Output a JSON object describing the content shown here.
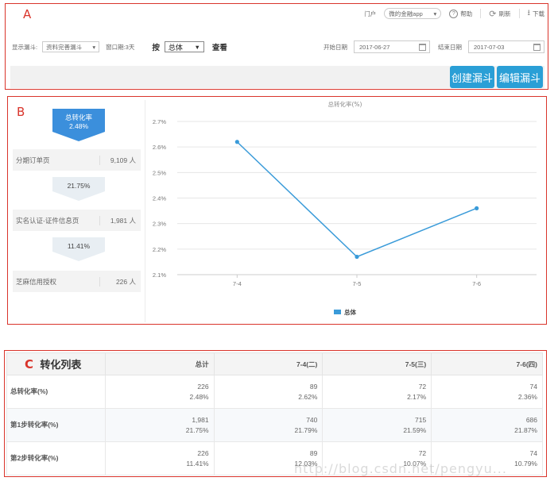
{
  "labels": {
    "a": "A",
    "b": "B",
    "c": "C"
  },
  "topbar": {
    "portal_label": "门户",
    "portal_value": "微的金融app",
    "help_label": "帮助",
    "refresh_label": "刷新",
    "download_label": "下载"
  },
  "filters": {
    "display_funnel_label": "显示漏斗:",
    "display_funnel_value": "资料完善漏斗",
    "window_label": "窗口期:3天",
    "by_label": "按",
    "dimension_value": "总体",
    "view_label": "查看",
    "start_date_label": "开始日期",
    "start_date": "2017-06-27",
    "end_date_label": "结束日期",
    "end_date": "2017-07-03"
  },
  "buttons": {
    "create": "创建漏斗",
    "edit": "编辑漏斗"
  },
  "funnel": {
    "total_label": "总转化率",
    "total_rate": "2.48%",
    "steps": [
      {
        "name": "分期订单页",
        "count": "9,109 人"
      },
      {
        "name": "实名认证-证件信息页",
        "count": "1,981 人"
      },
      {
        "name": "芝麻信用授权",
        "count": "226 人"
      }
    ],
    "step_rates": [
      "21.75%",
      "11.41%"
    ]
  },
  "chart_data": {
    "type": "line",
    "title": "总转化率(%)",
    "x": [
      "7-4",
      "7-5",
      "7-6"
    ],
    "series": [
      {
        "name": "总体",
        "values": [
          2.62,
          2.17,
          2.36
        ]
      }
    ],
    "ylim": [
      2.1,
      2.7
    ],
    "yticks": [
      "2.7%",
      "2.6%",
      "2.5%",
      "2.4%",
      "2.3%",
      "2.2%",
      "2.1%"
    ],
    "ytick_values": [
      2.7,
      2.6,
      2.5,
      2.4,
      2.3,
      2.2,
      2.1
    ],
    "grid": true,
    "legend": "bottom-center",
    "color": "#3a9bd9"
  },
  "table": {
    "title": "转化列表",
    "columns": [
      "总计",
      "7-4(二)",
      "7-5(三)",
      "7-6(四)"
    ],
    "rows": [
      {
        "label": "总转化率(%)",
        "cells": [
          [
            "226",
            "2.48%"
          ],
          [
            "89",
            "2.62%"
          ],
          [
            "72",
            "2.17%"
          ],
          [
            "74",
            "2.36%"
          ]
        ]
      },
      {
        "label": "第1步转化率(%)",
        "cells": [
          [
            "1,981",
            "21.75%"
          ],
          [
            "740",
            "21.79%"
          ],
          [
            "715",
            "21.59%"
          ],
          [
            "686",
            "21.87%"
          ]
        ]
      },
      {
        "label": "第2步转化率(%)",
        "cells": [
          [
            "226",
            "11.41%"
          ],
          [
            "89",
            "12.03%"
          ],
          [
            "72",
            "10.07%"
          ],
          [
            "74",
            "10.79%"
          ]
        ]
      }
    ]
  },
  "watermark": "http://blog.csdn.net/pengyu..."
}
